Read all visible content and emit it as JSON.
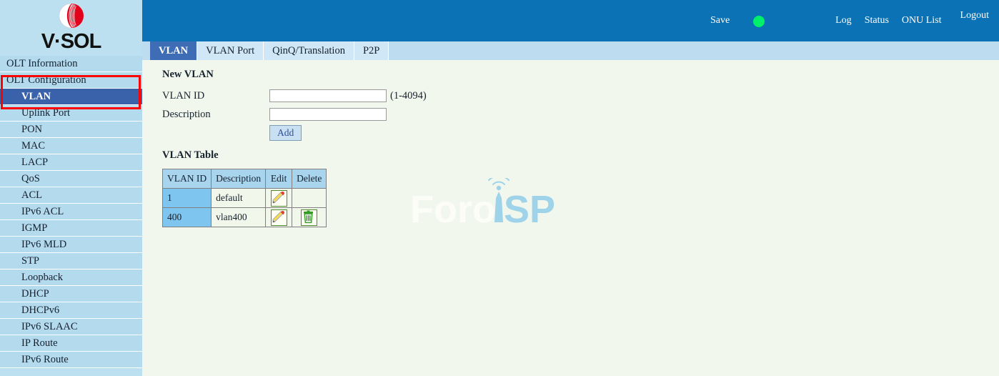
{
  "brand": {
    "logo_text": "V·SOL",
    "logo_icon": "vsol-sphere-logo"
  },
  "topbar": {
    "save_label": "Save",
    "status_indicator": "green-status-dot",
    "status_color": "#00f06a",
    "background_color": "#0a72b5",
    "links": [
      {
        "label": "Log"
      },
      {
        "label": "Status"
      },
      {
        "label": "ONU List"
      },
      {
        "label": "Logout"
      }
    ]
  },
  "sidebar": {
    "background_color": "#b4daee",
    "selected_color": "#3a62ab",
    "annotation_color": "#ff0000",
    "items": [
      {
        "label": "OLT Information",
        "level": "group",
        "selected": false
      },
      {
        "label": "OLT Configuration",
        "level": "group",
        "selected": false
      },
      {
        "label": "VLAN",
        "level": "sub",
        "selected": true
      },
      {
        "label": "Uplink Port",
        "level": "sub",
        "selected": false
      },
      {
        "label": "PON",
        "level": "sub",
        "selected": false
      },
      {
        "label": "MAC",
        "level": "sub",
        "selected": false
      },
      {
        "label": "LACP",
        "level": "sub",
        "selected": false
      },
      {
        "label": "QoS",
        "level": "sub",
        "selected": false
      },
      {
        "label": "ACL",
        "level": "sub",
        "selected": false
      },
      {
        "label": "IPv6 ACL",
        "level": "sub",
        "selected": false
      },
      {
        "label": "IGMP",
        "level": "sub",
        "selected": false
      },
      {
        "label": "IPv6 MLD",
        "level": "sub",
        "selected": false
      },
      {
        "label": "STP",
        "level": "sub",
        "selected": false
      },
      {
        "label": "Loopback",
        "level": "sub",
        "selected": false
      },
      {
        "label": "DHCP",
        "level": "sub",
        "selected": false
      },
      {
        "label": "DHCPv6",
        "level": "sub",
        "selected": false
      },
      {
        "label": "IPv6 SLAAC",
        "level": "sub",
        "selected": false
      },
      {
        "label": "IP Route",
        "level": "sub",
        "selected": false
      },
      {
        "label": "IPv6 Route",
        "level": "sub",
        "selected": false
      }
    ]
  },
  "tabs": [
    {
      "label": "VLAN",
      "active": true
    },
    {
      "label": "VLAN Port",
      "active": false
    },
    {
      "label": "QinQ/Translation",
      "active": false
    },
    {
      "label": "P2P",
      "active": false
    }
  ],
  "new_vlan": {
    "title": "New VLAN",
    "vlan_id_label": "VLAN ID",
    "vlan_id_value": "",
    "vlan_id_placeholder": "",
    "vlan_id_hint": "(1-4094)",
    "description_label": "Description",
    "description_value": "",
    "description_placeholder": "",
    "add_label": "Add"
  },
  "vlan_table": {
    "title": "VLAN Table",
    "columns": [
      "VLAN ID",
      "Description",
      "Edit",
      "Delete"
    ],
    "rows": [
      {
        "vlan_id": "1",
        "description": "default",
        "edit_icon": "edit-pencil-icon",
        "delete_icon": ""
      },
      {
        "vlan_id": "400",
        "description": "vlan400",
        "edit_icon": "edit-pencil-icon",
        "delete_icon": "delete-trash-icon"
      }
    ]
  },
  "watermark": {
    "text_left": "Foro",
    "text_right": "iSP",
    "icon": "wifi-waves-icon",
    "color": "#8fcfe8"
  }
}
